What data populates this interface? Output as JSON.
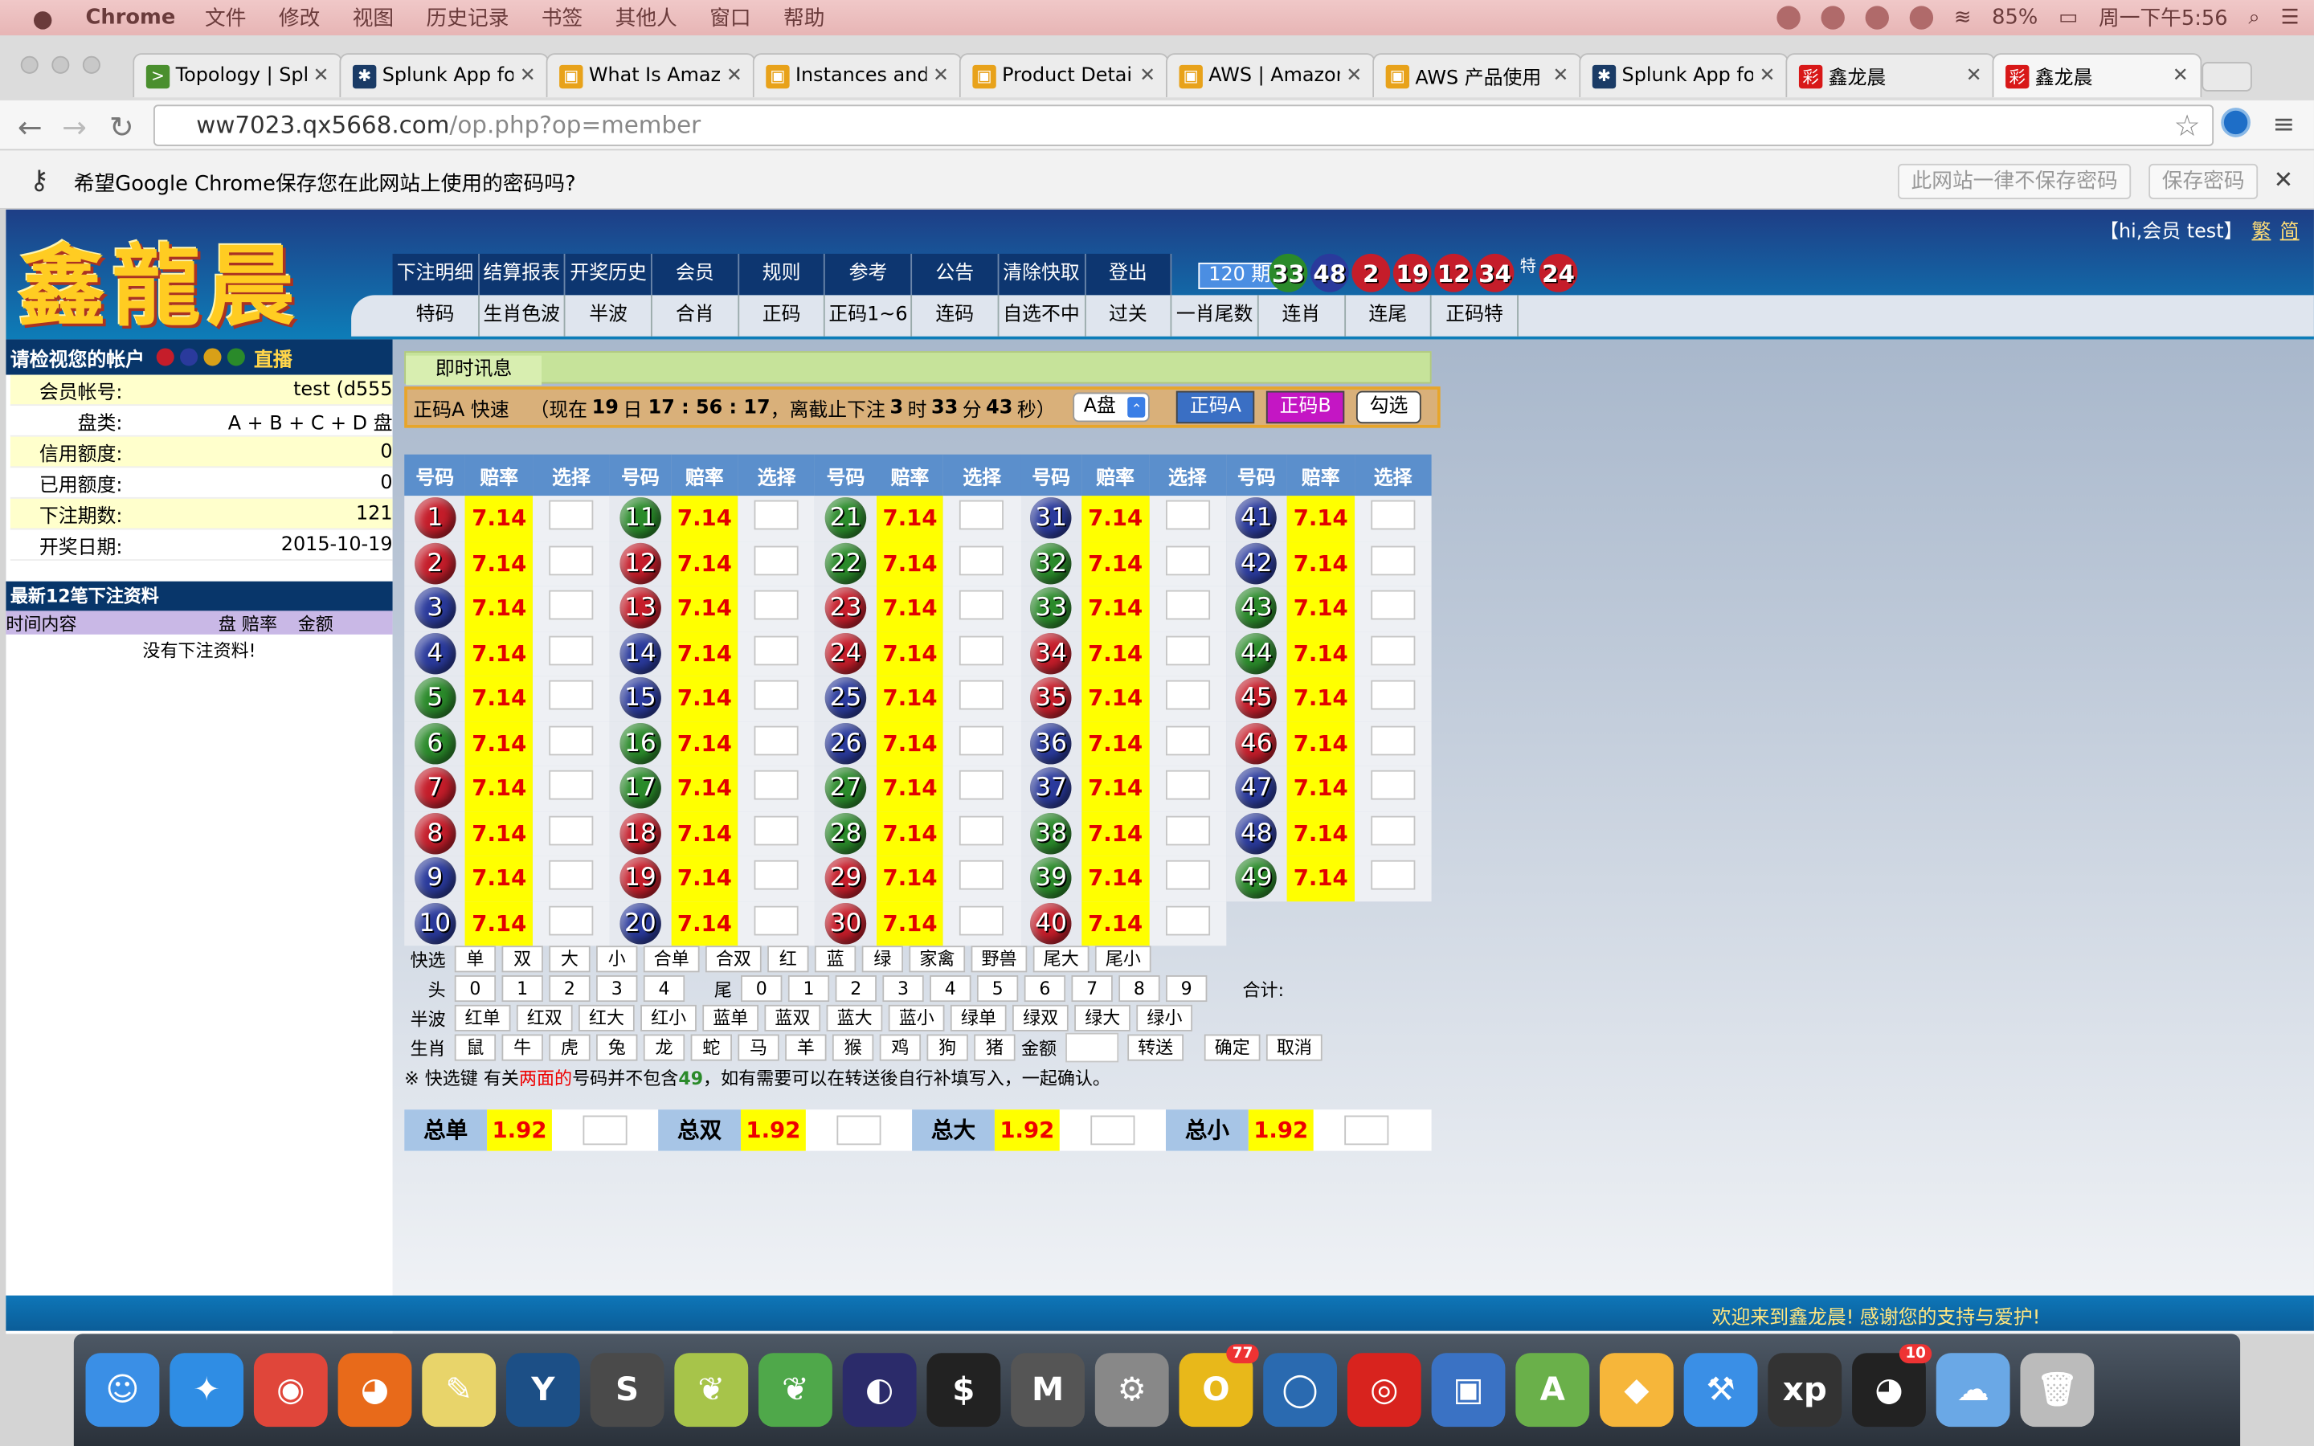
{
  "menubar": {
    "apple": "",
    "app": "Chrome",
    "items": [
      "文件",
      "修改",
      "视图",
      "历史记录",
      "书签",
      "其他人",
      "窗口",
      "帮助"
    ],
    "battery": "85%",
    "clock": "周一下午5:56"
  },
  "tabs": [
    {
      "title": "Topology | Spl",
      "icon": ">",
      "color": "#4a8f2e"
    },
    {
      "title": "Splunk App fo",
      "icon": "✱",
      "color": "#1a3b66"
    },
    {
      "title": "What Is Amazo",
      "icon": "▣",
      "color": "#e8a21a"
    },
    {
      "title": "Instances and",
      "icon": "▣",
      "color": "#e8a21a"
    },
    {
      "title": "Product Detail",
      "icon": "▣",
      "color": "#e8a21a"
    },
    {
      "title": "AWS | Amazon",
      "icon": "▣",
      "color": "#e8a21a"
    },
    {
      "title": "AWS 产品使用",
      "icon": "▣",
      "color": "#e8a21a"
    },
    {
      "title": "Splunk App fo",
      "icon": "✱",
      "color": "#1a3b66"
    },
    {
      "title": "鑫龙晨",
      "icon": "彩",
      "color": "#d81818"
    },
    {
      "title": "鑫龙晨",
      "icon": "彩",
      "color": "#d81818"
    }
  ],
  "address": {
    "host": "ww7023.qx5668.com",
    "path": "/op.php?op=member"
  },
  "infobar": {
    "message": "希望Google Chrome保存您在此网站上使用的密码吗?",
    "never": "此网站一律不保存密码",
    "save": "保存密码"
  },
  "site": {
    "logo": "鑫龍晨",
    "greeting": "【hi,会员 test】",
    "trad": "繁",
    "simp": "简",
    "nav1": [
      "下注明细",
      "结算报表",
      "开奖历史",
      "会员",
      "规则",
      "参考",
      "公告",
      "清除快取",
      "登出"
    ],
    "nav2": [
      "特码",
      "生肖色波",
      "半波",
      "合肖",
      "正码",
      "正码1~6",
      "连码",
      "自选不中",
      "过关",
      "一肖尾数",
      "连肖",
      "连尾",
      "正码特"
    ],
    "issue": "120 期",
    "draw_balls": [
      {
        "n": "33",
        "c": "#2a8a2a"
      },
      {
        "n": "48",
        "c": "#2a3a9c"
      },
      {
        "n": "2",
        "c": "#c51d2a"
      },
      {
        "n": "19",
        "c": "#c51d2a"
      },
      {
        "n": "12",
        "c": "#c51d2a"
      },
      {
        "n": "34",
        "c": "#c51d2a"
      }
    ],
    "special_label": "特",
    "special_ball": {
      "n": "24",
      "c": "#c51d2a"
    }
  },
  "account": {
    "title": "请检视您的帐户",
    "live": "直播",
    "rows": [
      {
        "label": "会员帐号:",
        "value": "test (d555"
      },
      {
        "label": "盘类:",
        "value": "A + B + C + D 盘"
      },
      {
        "label": "信用额度:",
        "value": "0"
      },
      {
        "label": "已用额度:",
        "value": "0"
      },
      {
        "label": "下注期数:",
        "value": "121"
      },
      {
        "label": "开奖日期:",
        "value": "2015-10-19"
      }
    ],
    "recent_title": "最新12笔下注资料",
    "recent_cols": [
      "时间内容",
      "盘 赔率",
      "金额"
    ],
    "recent_empty": "没有下注资料!"
  },
  "main": {
    "info_tab": "即时讯息",
    "mode": "正码A 快速",
    "time_prefix": "（现在",
    "day": "19",
    "day_suffix": "日",
    "time": "17 : 56 : 17",
    "deadline_prefix": "，离截止下注",
    "hours": "3",
    "hours_suffix": "时",
    "minutes": "33",
    "minutes_suffix": "分",
    "seconds": "43",
    "seconds_suffix": "秒）",
    "pan_select": "A盘",
    "btn_a": "正码A",
    "btn_b": "正码B",
    "btn_check": "勾选",
    "headers": [
      "号码",
      "赔率",
      "选择"
    ],
    "rate": "7.14",
    "ball_colors": {
      "1": "#c51d2a",
      "2": "#c51d2a",
      "3": "#2a3a9c",
      "4": "#2a3a9c",
      "5": "#2a8a2a",
      "6": "#2a8a2a",
      "7": "#c51d2a",
      "8": "#c51d2a",
      "9": "#2a3a9c",
      "10": "#2a3a9c",
      "11": "#2a8a2a",
      "12": "#c51d2a",
      "13": "#c51d2a",
      "14": "#2a3a9c",
      "15": "#2a3a9c",
      "16": "#2a8a2a",
      "17": "#2a8a2a",
      "18": "#c51d2a",
      "19": "#c51d2a",
      "20": "#2a3a9c",
      "21": "#2a8a2a",
      "22": "#2a8a2a",
      "23": "#c51d2a",
      "24": "#c51d2a",
      "25": "#2a3a9c",
      "26": "#2a3a9c",
      "27": "#2a8a2a",
      "28": "#2a8a2a",
      "29": "#c51d2a",
      "30": "#c51d2a",
      "31": "#2a3a9c",
      "32": "#2a8a2a",
      "33": "#2a8a2a",
      "34": "#c51d2a",
      "35": "#c51d2a",
      "36": "#2a3a9c",
      "37": "#2a3a9c",
      "38": "#2a8a2a",
      "39": "#2a8a2a",
      "40": "#c51d2a",
      "41": "#2a3a9c",
      "42": "#2a3a9c",
      "43": "#2a8a2a",
      "44": "#2a8a2a",
      "45": "#c51d2a",
      "46": "#c51d2a",
      "47": "#2a3a9c",
      "48": "#2a3a9c",
      "49": "#2a8a2a"
    },
    "quick": {
      "label_quick": "快选",
      "quick_keys": [
        "单",
        "双",
        "大",
        "小",
        "合单",
        "合双",
        "红",
        "蓝",
        "绿",
        "家禽",
        "野兽",
        "尾大",
        "尾小"
      ],
      "label_head": "头",
      "head_keys": [
        "0",
        "1",
        "2",
        "3",
        "4"
      ],
      "label_tail": "尾",
      "tail_keys": [
        "0",
        "1",
        "2",
        "3",
        "4",
        "5",
        "6",
        "7",
        "8",
        "9"
      ],
      "sum_label": "合计:",
      "label_half": "半波",
      "half_keys": [
        "红单",
        "红双",
        "红大",
        "红小",
        "蓝单",
        "蓝双",
        "蓝大",
        "蓝小",
        "绿单",
        "绿双",
        "绿大",
        "绿小"
      ],
      "label_zodiac": "生肖",
      "zodiac_keys": [
        "鼠",
        "牛",
        "虎",
        "兔",
        "龙",
        "蛇",
        "马",
        "羊",
        "猴",
        "鸡",
        "狗",
        "猪"
      ],
      "amount_label": "金额",
      "transfer": "转送",
      "confirm": "确定",
      "cancel": "取消"
    },
    "note": {
      "a": "※ 快选键 有关",
      "red": "两面的",
      "b": "号码并不包含",
      "num": "49",
      "c": "，如有需要可以在转送後自行补填写入，一起确认。"
    },
    "totals": [
      {
        "label": "总单",
        "rate": "1.92"
      },
      {
        "label": "总双",
        "rate": "1.92"
      },
      {
        "label": "总大",
        "rate": "1.92"
      },
      {
        "label": "总小",
        "rate": "1.92"
      }
    ]
  },
  "footer": "欢迎来到鑫龙晨! 感谢您的支持与爱护!",
  "dock": [
    {
      "name": "finder-icon",
      "c": "#3a8fe6",
      "g": "☺"
    },
    {
      "name": "safari-icon",
      "c": "#2f8de4",
      "g": "✦"
    },
    {
      "name": "chrome-icon",
      "c": "#e0463a",
      "g": "◉"
    },
    {
      "name": "firefox-icon",
      "c": "#e86a1a",
      "g": "◕"
    },
    {
      "name": "stickies-icon",
      "c": "#e8d46a",
      "g": "✎"
    },
    {
      "name": "sourcetree-icon",
      "c": "#1c4f86",
      "g": "Y"
    },
    {
      "name": "sublime-icon",
      "c": "#4a4a4a",
      "g": "S"
    },
    {
      "name": "app-leaf-icon",
      "c": "#a7c44a",
      "g": "❦"
    },
    {
      "name": "app-leaf-green-icon",
      "c": "#4fa84a",
      "g": "❦"
    },
    {
      "name": "eclipse-icon",
      "c": "#2b2b6a",
      "g": "◐"
    },
    {
      "name": "terminal-icon",
      "c": "#222",
      "g": "$"
    },
    {
      "name": "markdown-icon",
      "c": "#555",
      "g": "M"
    },
    {
      "name": "system-preferences-icon",
      "c": "#888",
      "g": "⚙"
    },
    {
      "name": "opera-icon",
      "c": "#e8b81a",
      "g": "O",
      "badge": "77"
    },
    {
      "name": "chat-icon",
      "c": "#2a6ab0",
      "g": "◯"
    },
    {
      "name": "netease-music-icon",
      "c": "#d8231e",
      "g": "◎"
    },
    {
      "name": "virtualbox-icon",
      "c": "#3a72c4",
      "g": "▣"
    },
    {
      "name": "android-studio-icon",
      "c": "#6ab04a",
      "g": "A"
    },
    {
      "name": "sketch-icon",
      "c": "#f6b63a",
      "g": "◆"
    },
    {
      "name": "xcode-icon",
      "c": "#3a8fe6",
      "g": "⚒"
    },
    {
      "name": "windows-xp-icon",
      "c": "#333",
      "g": "xp"
    },
    {
      "name": "qq-icon",
      "c": "#222",
      "g": "◕",
      "badge": "10"
    },
    {
      "name": "weather-icon",
      "c": "#6aa8e6",
      "g": "☁"
    },
    {
      "name": "trash-icon",
      "c": "#bbb",
      "g": "🗑"
    }
  ]
}
